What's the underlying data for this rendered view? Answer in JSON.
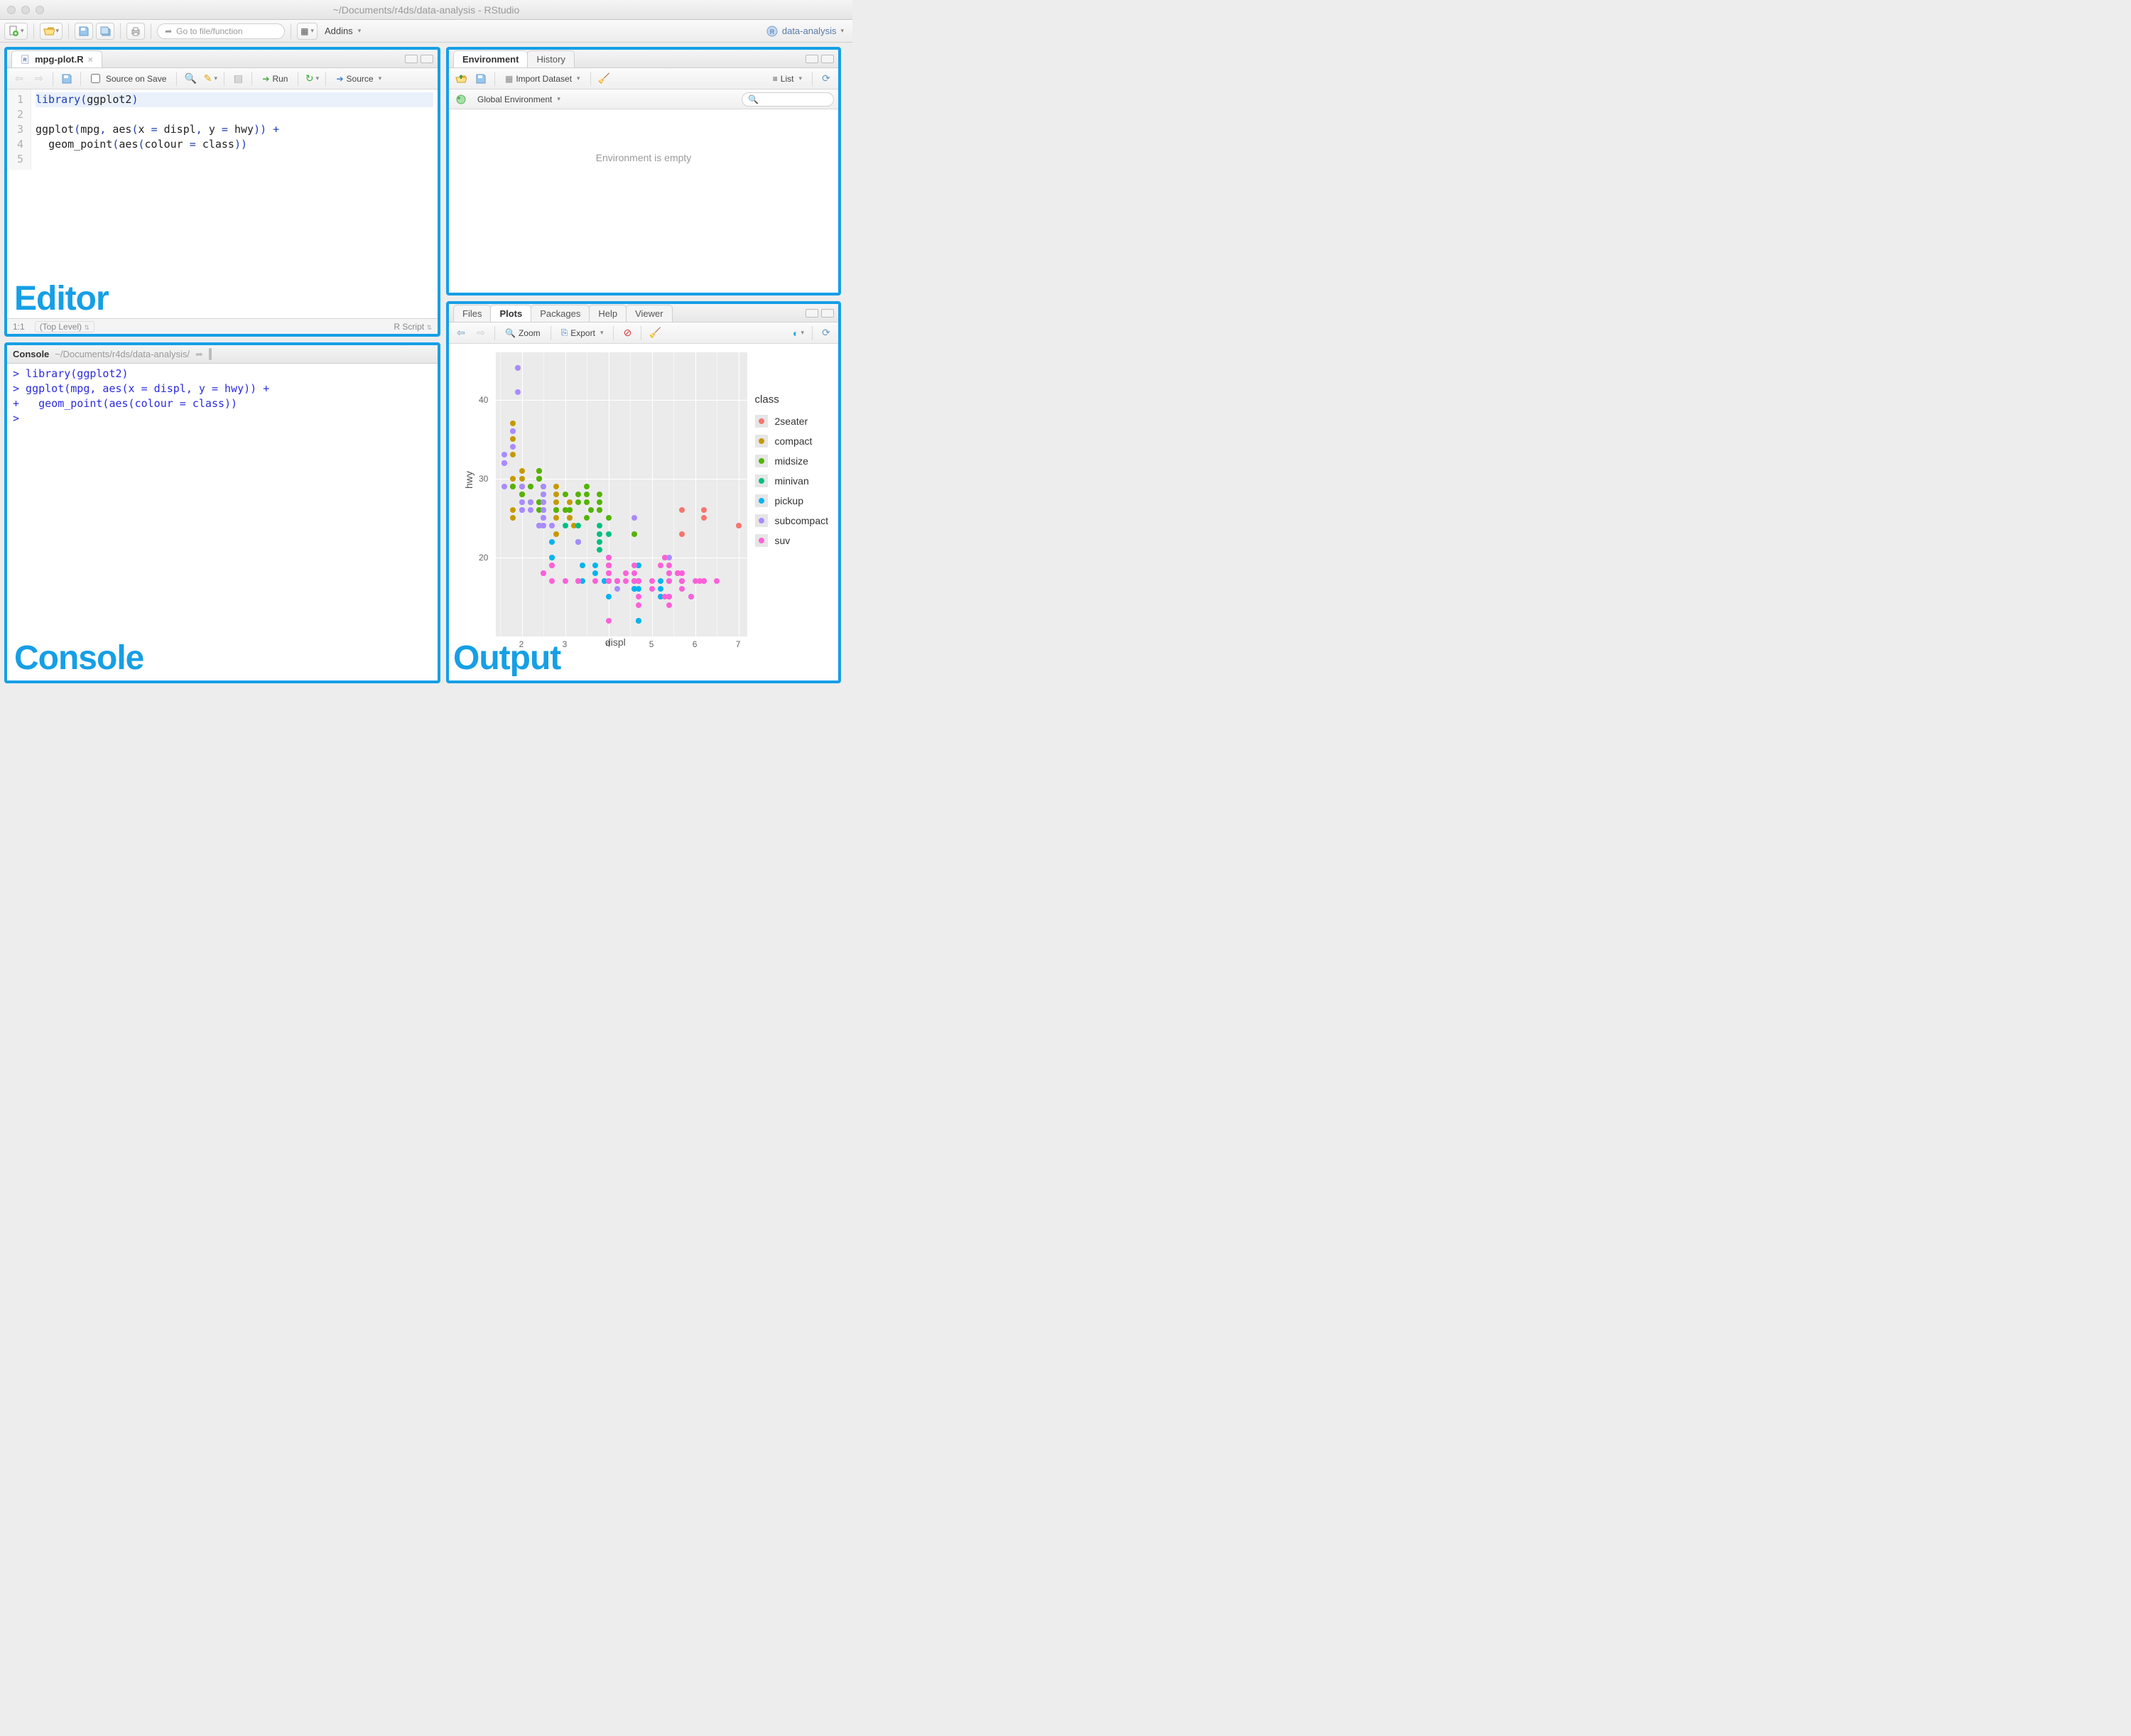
{
  "window": {
    "title": "~/Documents/r4ds/data-analysis - RStudio"
  },
  "toolbar": {
    "goto_placeholder": "Go to file/function",
    "addins": "Addins",
    "project": "data-analysis"
  },
  "annotations": {
    "editor": "Editor",
    "console": "Console",
    "output": "Output"
  },
  "editor": {
    "tab_filename": "mpg-plot.R",
    "source_on_save": "Source on Save",
    "run": "Run",
    "source": "Source",
    "lines": [
      "library(ggplot2)",
      "",
      "ggplot(mpg, aes(x = displ, y = hwy)) +",
      "  geom_point(aes(colour = class))",
      ""
    ],
    "cursor": "1:1",
    "scope": "(Top Level)",
    "lang": "R Script"
  },
  "console": {
    "title": "Console",
    "path": "~/Documents/r4ds/data-analysis/",
    "lines": [
      "> library(ggplot2)",
      "> ggplot(mpg, aes(x = displ, y = hwy)) +",
      "+   geom_point(aes(colour = class))",
      "> "
    ]
  },
  "env": {
    "tabs": [
      "Environment",
      "History"
    ],
    "import": "Import Dataset",
    "list": "List",
    "scope": "Global Environment",
    "empty": "Environment is empty"
  },
  "output": {
    "tabs": [
      "Files",
      "Plots",
      "Packages",
      "Help",
      "Viewer"
    ],
    "zoom": "Zoom",
    "export": "Export"
  },
  "chart_data": {
    "type": "scatter",
    "xlabel": "displ",
    "ylabel": "hwy",
    "xlim": [
      1.4,
      7.2
    ],
    "ylim": [
      10,
      46
    ],
    "xticks": [
      2,
      3,
      4,
      5,
      6,
      7
    ],
    "yticks": [
      20,
      30,
      40
    ],
    "legend_title": "class",
    "classes": [
      {
        "name": "2seater",
        "color": "#F4766D"
      },
      {
        "name": "compact",
        "color": "#C59A00"
      },
      {
        "name": "midsize",
        "color": "#53B400"
      },
      {
        "name": "minivan",
        "color": "#00BF83"
      },
      {
        "name": "pickup",
        "color": "#00B4EF"
      },
      {
        "name": "subcompact",
        "color": "#A98BFF"
      },
      {
        "name": "suv",
        "color": "#FB61D7"
      }
    ],
    "series": [
      {
        "class": "2seater",
        "points": [
          [
            5.7,
            26
          ],
          [
            5.7,
            23
          ],
          [
            6.2,
            26
          ],
          [
            6.2,
            25
          ],
          [
            7.0,
            24
          ]
        ]
      },
      {
        "class": "compact",
        "points": [
          [
            1.8,
            29
          ],
          [
            1.8,
            29
          ],
          [
            2.0,
            31
          ],
          [
            2.0,
            30
          ],
          [
            2.8,
            26
          ],
          [
            2.8,
            26
          ],
          [
            3.1,
            27
          ],
          [
            1.8,
            26
          ],
          [
            1.8,
            25
          ],
          [
            2.0,
            28
          ],
          [
            2.0,
            29
          ],
          [
            2.8,
            27
          ],
          [
            2.8,
            25
          ],
          [
            3.1,
            25
          ],
          [
            3.1,
            25
          ],
          [
            2.4,
            30
          ],
          [
            2.4,
            30
          ],
          [
            2.5,
            26
          ],
          [
            2.5,
            27
          ],
          [
            2.2,
            27
          ],
          [
            2.2,
            29
          ],
          [
            2.4,
            31
          ],
          [
            2.4,
            31
          ],
          [
            3.0,
            26
          ],
          [
            1.8,
            30
          ],
          [
            1.8,
            33
          ],
          [
            1.8,
            35
          ],
          [
            1.8,
            37
          ],
          [
            2.0,
            26
          ],
          [
            2.0,
            29
          ],
          [
            2.0,
            28
          ],
          [
            2.8,
            28
          ],
          [
            2.8,
            29
          ],
          [
            1.9,
            44
          ],
          [
            2.0,
            29
          ],
          [
            2.0,
            29
          ],
          [
            2.0,
            29
          ],
          [
            2.0,
            28
          ],
          [
            2.5,
            29
          ],
          [
            2.5,
            29
          ],
          [
            2.8,
            23
          ],
          [
            3.2,
            24
          ]
        ]
      },
      {
        "class": "midsize",
        "points": [
          [
            2.4,
            27
          ],
          [
            2.4,
            30
          ],
          [
            3.1,
            26
          ],
          [
            3.5,
            29
          ],
          [
            3.6,
            26
          ],
          [
            2.4,
            26
          ],
          [
            2.4,
            27
          ],
          [
            2.4,
            30
          ],
          [
            2.4,
            31
          ],
          [
            2.5,
            26
          ],
          [
            2.5,
            28
          ],
          [
            3.3,
            28
          ],
          [
            3.3,
            27
          ],
          [
            3.5,
            25
          ],
          [
            3.8,
            26
          ],
          [
            3.8,
            28
          ],
          [
            3.8,
            27
          ],
          [
            3.8,
            26
          ],
          [
            4.0,
            25
          ],
          [
            4.6,
            23
          ],
          [
            2.2,
            29
          ],
          [
            2.2,
            27
          ],
          [
            3.0,
            26
          ],
          [
            3.0,
            28
          ],
          [
            3.5,
            27
          ],
          [
            1.8,
            29
          ],
          [
            2.0,
            28
          ],
          [
            2.0,
            27
          ],
          [
            2.8,
            26
          ],
          [
            3.1,
            26
          ],
          [
            3.5,
            28
          ]
        ]
      },
      {
        "class": "minivan",
        "points": [
          [
            2.4,
            24
          ],
          [
            3.0,
            24
          ],
          [
            3.3,
            22
          ],
          [
            3.3,
            22
          ],
          [
            3.3,
            24
          ],
          [
            3.8,
            22
          ],
          [
            3.8,
            24
          ],
          [
            3.8,
            21
          ],
          [
            3.8,
            23
          ],
          [
            4.0,
            23
          ],
          [
            3.3,
            17
          ]
        ]
      },
      {
        "class": "pickup",
        "points": [
          [
            3.7,
            19
          ],
          [
            3.7,
            18
          ],
          [
            3.9,
            17
          ],
          [
            3.9,
            17
          ],
          [
            4.7,
            19
          ],
          [
            4.7,
            19
          ],
          [
            4.7,
            12
          ],
          [
            5.2,
            17
          ],
          [
            5.2,
            15
          ],
          [
            4.2,
            17
          ],
          [
            4.2,
            17
          ],
          [
            4.6,
            16
          ],
          [
            4.6,
            16
          ],
          [
            4.6,
            17
          ],
          [
            5.4,
            17
          ],
          [
            5.4,
            15
          ],
          [
            5.4,
            18
          ],
          [
            2.7,
            20
          ],
          [
            2.7,
            20
          ],
          [
            2.7,
            22
          ],
          [
            3.4,
            17
          ],
          [
            3.4,
            19
          ],
          [
            4.0,
            20
          ],
          [
            4.0,
            17
          ],
          [
            4.7,
            17
          ],
          [
            4.7,
            16
          ],
          [
            4.7,
            12
          ],
          [
            5.2,
            16
          ],
          [
            5.7,
            17
          ],
          [
            5.9,
            15
          ],
          [
            4.0,
            15
          ],
          [
            4.6,
            17
          ]
        ]
      },
      {
        "class": "subcompact",
        "points": [
          [
            1.6,
            33
          ],
          [
            1.6,
            32
          ],
          [
            1.6,
            32
          ],
          [
            1.6,
            29
          ],
          [
            1.6,
            32
          ],
          [
            1.8,
            34
          ],
          [
            1.8,
            36
          ],
          [
            1.8,
            36
          ],
          [
            2.0,
            29
          ],
          [
            2.4,
            24
          ],
          [
            2.4,
            24
          ],
          [
            2.5,
            24
          ],
          [
            2.5,
            24
          ],
          [
            3.3,
            22
          ],
          [
            2.0,
            26
          ],
          [
            2.0,
            26
          ],
          [
            2.0,
            27
          ],
          [
            2.0,
            26
          ],
          [
            2.7,
            24
          ],
          [
            2.7,
            24
          ],
          [
            2.2,
            26
          ],
          [
            2.2,
            27
          ],
          [
            2.5,
            25
          ],
          [
            2.5,
            25
          ],
          [
            2.5,
            26
          ],
          [
            2.5,
            27
          ],
          [
            1.9,
            44
          ],
          [
            1.9,
            41
          ],
          [
            2.0,
            29
          ],
          [
            2.5,
            28
          ],
          [
            2.5,
            29
          ],
          [
            4.0,
            20
          ],
          [
            4.2,
            16
          ],
          [
            4.6,
            25
          ],
          [
            5.4,
            20
          ]
        ]
      },
      {
        "class": "suv",
        "points": [
          [
            5.3,
            20
          ],
          [
            5.3,
            15
          ],
          [
            5.3,
            20
          ],
          [
            5.7,
            17
          ],
          [
            6.0,
            17
          ],
          [
            5.7,
            18
          ],
          [
            5.7,
            17
          ],
          [
            6.2,
            17
          ],
          [
            6.2,
            17
          ],
          [
            6.5,
            17
          ],
          [
            2.5,
            18
          ],
          [
            2.5,
            18
          ],
          [
            2.7,
            19
          ],
          [
            2.7,
            19
          ],
          [
            2.7,
            17
          ],
          [
            3.0,
            17
          ],
          [
            3.7,
            17
          ],
          [
            4.0,
            17
          ],
          [
            4.0,
            19
          ],
          [
            4.0,
            18
          ],
          [
            4.0,
            17
          ],
          [
            4.0,
            17
          ],
          [
            4.0,
            19
          ],
          [
            4.0,
            19
          ],
          [
            4.0,
            17
          ],
          [
            4.0,
            20
          ],
          [
            4.2,
            17
          ],
          [
            4.2,
            17
          ],
          [
            4.4,
            18
          ],
          [
            4.4,
            17
          ],
          [
            4.6,
            18
          ],
          [
            4.6,
            17
          ],
          [
            4.6,
            19
          ],
          [
            4.7,
            14
          ],
          [
            4.7,
            17
          ],
          [
            4.7,
            15
          ],
          [
            4.7,
            17
          ],
          [
            4.7,
            17
          ],
          [
            5.0,
            16
          ],
          [
            5.0,
            17
          ],
          [
            5.2,
            19
          ],
          [
            5.4,
            17
          ],
          [
            5.4,
            19
          ],
          [
            5.4,
            18
          ],
          [
            5.6,
            18
          ],
          [
            5.7,
            18
          ],
          [
            5.7,
            17
          ],
          [
            5.7,
            16
          ],
          [
            5.9,
            15
          ],
          [
            6.1,
            17
          ],
          [
            4.0,
            12
          ],
          [
            4.0,
            19
          ],
          [
            3.3,
            17
          ],
          [
            3.3,
            17
          ],
          [
            4.0,
            18
          ],
          [
            5.6,
            18
          ],
          [
            5.4,
            15
          ],
          [
            5.4,
            14
          ]
        ]
      }
    ]
  }
}
